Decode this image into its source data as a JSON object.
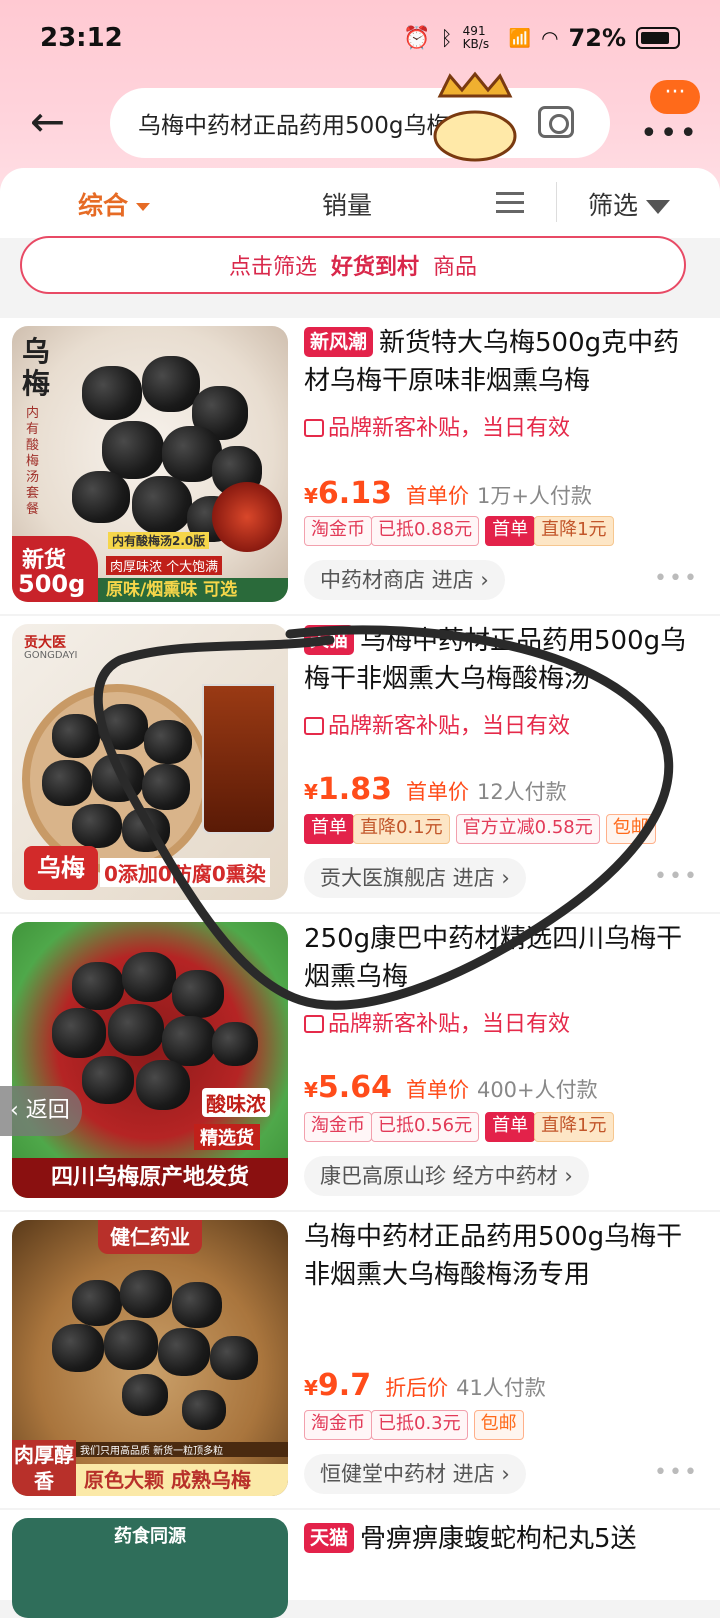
{
  "status": {
    "time": "23:12",
    "net_speed": "491 KB/s",
    "battery": "72%"
  },
  "search": {
    "query": "乌梅中药材正品药用500g乌梅干",
    "bubble": "···"
  },
  "sort": {
    "tabs": [
      "综合",
      "销量",
      "筛选"
    ]
  },
  "banner": {
    "parts": [
      "点击筛选",
      "好货到村",
      "商品"
    ]
  },
  "back_pill": "返回",
  "products": [
    {
      "badge": "新风潮",
      "title": "新货特大乌梅500g克中药材乌梅干原味非烟熏乌梅",
      "promo": "品牌新客补贴，当日有效",
      "yen": "¥",
      "price": "6.13",
      "price_label": "首单价",
      "sold": "1万+人付款",
      "chips": [
        "淘金币",
        "已抵0.88元",
        "首单",
        "直降1元"
      ],
      "shop": "中药材商店 进店 ›",
      "img_text": {
        "a": "乌梅",
        "b": "内有酸梅汤套餐",
        "c": "新货",
        "d": "500g",
        "e": "原味/烟熏味 可选",
        "f": "内有酸梅汤2.0版",
        "g": "肉厚味浓 个大饱满"
      }
    },
    {
      "badge": "天猫",
      "title": "乌梅中药材正品药用500g乌梅干非烟熏大乌梅酸梅汤",
      "promo": "品牌新客补贴，当日有效",
      "yen": "¥",
      "price": "1.83",
      "price_label": "首单价",
      "sold": "12人付款",
      "chips": [
        "首单",
        "直降0.1元",
        "官方立减0.58元",
        "包邮"
      ],
      "shop": "贡大医旗舰店 进店 ›",
      "img_text": {
        "a": "贡大医",
        "b": "GONGDAYI",
        "c": "乌梅",
        "d": "0添加0防腐0熏染"
      }
    },
    {
      "badge": "",
      "title": "250g康巴中药材精选四川乌梅干烟熏乌梅",
      "promo": "品牌新客补贴，当日有效",
      "yen": "¥",
      "price": "5.64",
      "price_label": "首单价",
      "sold": "400+人付款",
      "chips": [
        "淘金币",
        "已抵0.56元",
        "首单",
        "直降1元"
      ],
      "shop": "康巴高原山珍 经方中药材 ›",
      "img_text": {
        "a": "酸味浓",
        "b": "精选货",
        "c": "四川乌梅原产地发货"
      }
    },
    {
      "badge": "",
      "title": "乌梅中药材正品药用500g乌梅干非烟熏大乌梅酸梅汤专用",
      "promo": "",
      "yen": "¥",
      "price": "9.7",
      "price_label": "折后价",
      "sold": "41人付款",
      "chips": [
        "淘金币",
        "已抵0.3元",
        "包邮"
      ],
      "shop": "恒健堂中药材 进店 ›",
      "img_text": {
        "a": "健仁药业",
        "b": "肉厚醇香",
        "c": "原色大颗 成熟乌梅",
        "d": "我们只用高品质 新货一粒顶多粒"
      }
    },
    {
      "badge": "天猫",
      "title": "骨痹痹康蝮蛇枸杞丸5送",
      "img_text": {
        "a": "药食同源"
      }
    }
  ]
}
